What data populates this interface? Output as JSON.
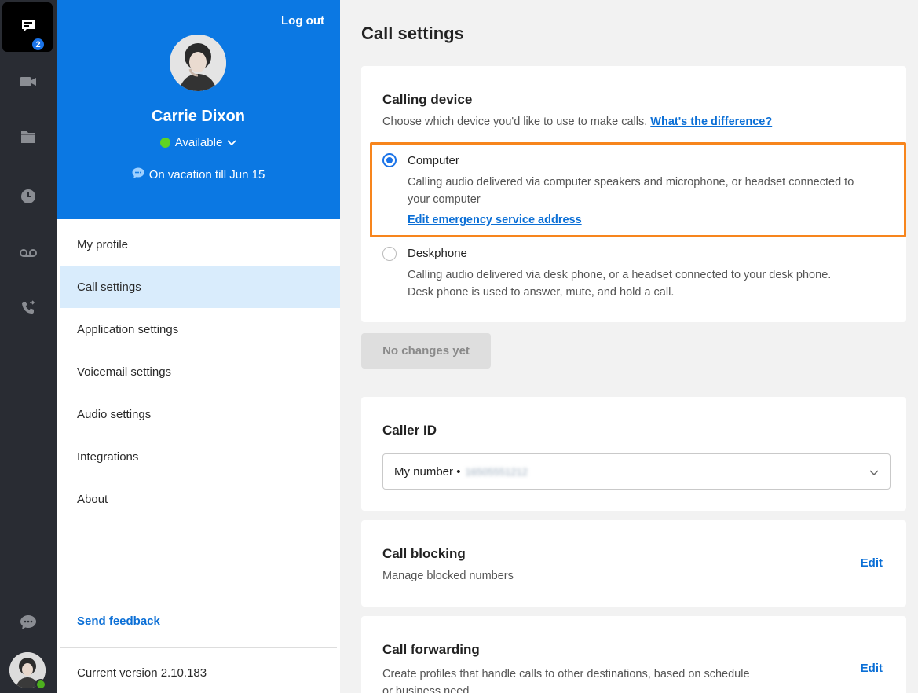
{
  "rail": {
    "chat_badge": "2",
    "icons": [
      "chat-icon",
      "video-icon",
      "folder-icon",
      "clock-icon",
      "voicemail-icon",
      "phone-icon",
      "feedback-chat-icon"
    ],
    "presence_color": "#4caf1e"
  },
  "profile": {
    "logout_label": "Log out",
    "name": "Carrie Dixon",
    "presence": "Available",
    "status": "On vacation till Jun 15"
  },
  "nav": {
    "items": [
      {
        "label": "My profile"
      },
      {
        "label": "Call settings",
        "active": true
      },
      {
        "label": "Application settings"
      },
      {
        "label": "Voicemail settings"
      },
      {
        "label": "Audio settings"
      },
      {
        "label": "Integrations"
      },
      {
        "label": "About"
      }
    ],
    "send_feedback": "Send feedback",
    "version": "Current version 2.10.183"
  },
  "main": {
    "title": "Call settings",
    "calling_device": {
      "title": "Calling device",
      "description": "Choose which device you'd like to use to make calls.",
      "help_link": "What's the difference?",
      "options": [
        {
          "label": "Computer",
          "selected": true,
          "description_line1": "Calling audio delivered via computer speakers and microphone, or headset connected to",
          "description_line2": "your computer",
          "link": "Edit emergency service address"
        },
        {
          "label": "Deskphone",
          "selected": false,
          "description_line1": "Calling audio delivered via desk phone, or a headset connected to your desk phone.",
          "description_line2": "Desk phone is used to answer, mute, and hold a call."
        }
      ]
    },
    "save_button": "No changes yet",
    "caller_id": {
      "title": "Caller ID",
      "select_label": "My number •",
      "select_value": "16505551212"
    },
    "call_blocking": {
      "title": "Call blocking",
      "description": "Manage blocked numbers",
      "edit": "Edit"
    },
    "call_forwarding": {
      "title": "Call forwarding",
      "description_line1": "Create profiles that handle calls to other destinations, based on schedule",
      "description_line2": "or business need",
      "edit": "Edit"
    },
    "accent_color": "#0b78e3",
    "highlight_color": "#f7851d"
  }
}
